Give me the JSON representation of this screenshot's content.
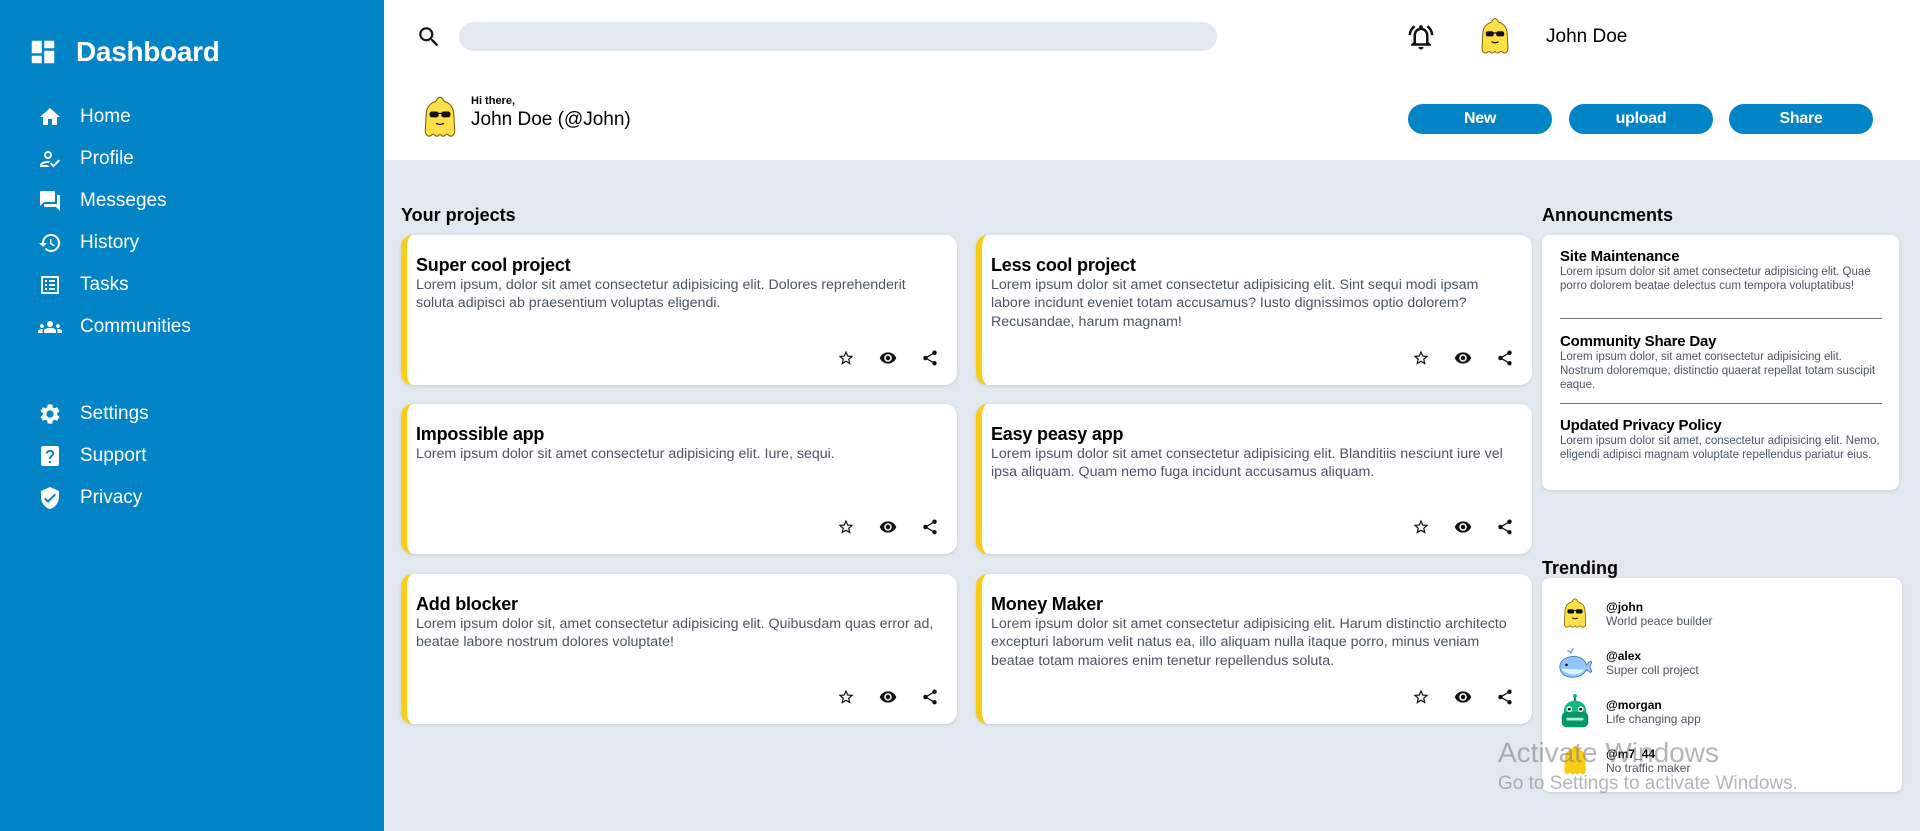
{
  "sidebar": {
    "brand": "Dashboard",
    "nav": [
      {
        "label": "Home",
        "icon": "home-icon"
      },
      {
        "label": "Profile",
        "icon": "profile-edit-icon"
      },
      {
        "label": "Messeges",
        "icon": "messages-icon"
      },
      {
        "label": "History",
        "icon": "history-icon"
      },
      {
        "label": "Tasks",
        "icon": "tasks-icon"
      },
      {
        "label": "Communities",
        "icon": "communities-icon"
      }
    ],
    "nav_secondary": [
      {
        "label": "Settings",
        "icon": "gear-icon"
      },
      {
        "label": "Support",
        "icon": "help-icon"
      },
      {
        "label": "Privacy",
        "icon": "shield-icon"
      }
    ]
  },
  "header": {
    "search_value": "",
    "user_name": "John Doe",
    "greeting_small": "Hi there,",
    "greeting_name": "John Doe (@John)",
    "buttons": {
      "new": "New",
      "upload": "upload",
      "share": "Share"
    }
  },
  "projects": {
    "title": "Your projects",
    "cards": [
      {
        "title": "Super cool project",
        "desc": "Lorem ipsum, dolor sit amet consectetur adipisicing elit. Dolores reprehenderit soluta adipisci ab praesentium voluptas eligendi."
      },
      {
        "title": "Less cool project",
        "desc": "Lorem ipsum dolor sit amet consectetur adipisicing elit. Sint sequi modi ipsam labore incidunt eveniet totam accusamus? Iusto dignissimos optio dolorem? Recusandae, harum magnam!"
      },
      {
        "title": "Impossible app",
        "desc": "Lorem ipsum dolor sit amet consectetur adipisicing elit. Iure, sequi."
      },
      {
        "title": "Easy peasy app",
        "desc": "Lorem ipsum dolor sit amet consectetur adipisicing elit. Blanditiis nesciunt iure vel ipsa aliquam. Quam nemo fuga incidunt accusamus aliquam."
      },
      {
        "title": "Add blocker",
        "desc": "Lorem ipsum dolor sit, amet consectetur adipisicing elit. Quibusdam quas error ad, beatae labore nostrum dolores voluptate!"
      },
      {
        "title": "Money Maker",
        "desc": "Lorem ipsum dolor sit amet consectetur adipisicing elit. Harum distinctio architecto excepturi laborum velit natus ea, illo aliquam nulla itaque porro, minus veniam beatae totam maiores enim tenetur repellendus soluta."
      }
    ]
  },
  "announcements": {
    "title": "Announcments",
    "items": [
      {
        "title": "Site Maintenance",
        "body": "Lorem ipsum dolor sit amet consectetur adipisicing elit. Quae porro dolorem beatae delectus cum tempora voluptatibus!"
      },
      {
        "title": "Community Share Day",
        "body": "Lorem ipsum dolor, sit amet consectetur adipisicing elit. Nostrum doloremque, distinctio quaerat repellat totam suscipit eaque."
      },
      {
        "title": "Updated Privacy Policy",
        "body": "Lorem ipsum dolor sit amet, consectetur adipisicing elit. Nemo, eligendi adipisci magnam voluptate repellendus pariatur eius."
      }
    ]
  },
  "trending": {
    "title": "Trending",
    "items": [
      {
        "handle": "@john",
        "tagline": "World peace builder",
        "avatar": "yellow-sunglasses-avatar"
      },
      {
        "handle": "@alex",
        "tagline": "Super coll project",
        "avatar": "whale-avatar"
      },
      {
        "handle": "@morgan",
        "tagline": "Life changing app",
        "avatar": "green-robot-avatar"
      },
      {
        "handle": "@m7_44",
        "tagline": "No traffic maker",
        "avatar": "yellow-avatar"
      }
    ]
  },
  "watermark": {
    "line1": "Activate Windows",
    "line2": "Go to Settings to activate Windows."
  },
  "colors": {
    "primary": "#0284c7",
    "background": "#e2e8f0",
    "accent": "#facc15"
  }
}
